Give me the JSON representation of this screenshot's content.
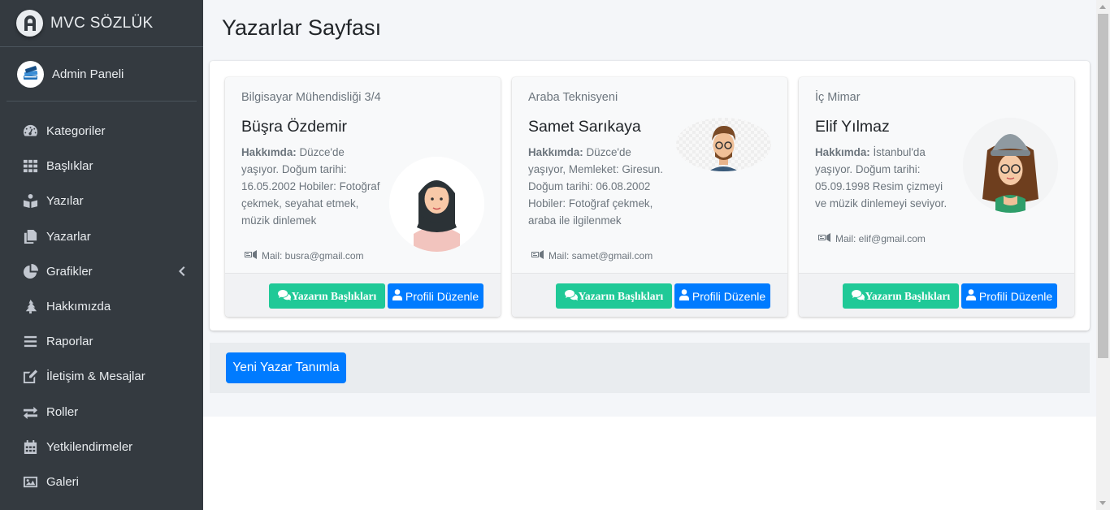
{
  "brand": {
    "title": "MVC SÖZLÜK",
    "icon": "brand-logo-icon"
  },
  "user": {
    "name": "Admin Paneli",
    "icon": "books-avatar-icon"
  },
  "sidebar": {
    "items": [
      {
        "label": "Kategoriler",
        "icon": "tachometer-icon"
      },
      {
        "label": "Başlıklar",
        "icon": "grid-icon"
      },
      {
        "label": "Yazılar",
        "icon": "book-reader-icon"
      },
      {
        "label": "Yazarlar",
        "icon": "copy-icon"
      },
      {
        "label": "Grafikler",
        "icon": "pie-chart-icon"
      },
      {
        "label": "Hakkımızda",
        "icon": "tree-icon"
      },
      {
        "label": "Raporlar",
        "icon": "bars-icon"
      },
      {
        "label": "İletişim & Mesajlar",
        "icon": "edit-icon"
      },
      {
        "label": "Roller",
        "icon": "exchange-icon"
      },
      {
        "label": "Yetkilendirmeler",
        "icon": "calendar-icon"
      },
      {
        "label": "Galeri",
        "icon": "image-icon"
      }
    ]
  },
  "page": {
    "title": "Yazarlar Sayfası"
  },
  "authors": [
    {
      "title": "Bilgisayar Mühendisliği 3/4",
      "name": "Büşra Özdemir",
      "about_label": "Hakkımda:",
      "about_text": " Düzce'de yaşıyor. Doğum tarihi: 16.05.2002 Hobiler: Fotoğraf çekmek, seyahat etmek, müzik dinlemek",
      "mail": "Mail: busra@gmail.com",
      "posts_button": "Yazarın Başlıkları",
      "edit_button": "Profili Düzenle"
    },
    {
      "title": "Araba Teknisyeni",
      "name": "Samet Sarıkaya",
      "about_label": "Hakkımda:",
      "about_text": " Düzce'de yaşıyor, Memleket: Giresun. Doğum tarihi: 06.08.2002 Hobiler: Fotoğraf çekmek, araba ile ilgilenmek",
      "mail": "Mail: samet@gmail.com",
      "posts_button": "Yazarın Başlıkları",
      "edit_button": "Profili Düzenle"
    },
    {
      "title": "İç Mimar",
      "name": "Elif Yılmaz",
      "about_label": "Hakkımda:",
      "about_text": " İstanbul'da yaşıyor. Doğum tarihi: 05.09.1998 Resim çizmeyi ve müzik dinlemeyi seviyor.",
      "mail": "Mail: elif@gmail.com",
      "posts_button": "Yazarın Başlıkları",
      "edit_button": "Profili Düzenle"
    }
  ],
  "actions": {
    "new_author": "Yeni Yazar Tanımla"
  },
  "colors": {
    "sidebar": "#343a40",
    "green": "#20c997",
    "blue": "#007bff"
  }
}
